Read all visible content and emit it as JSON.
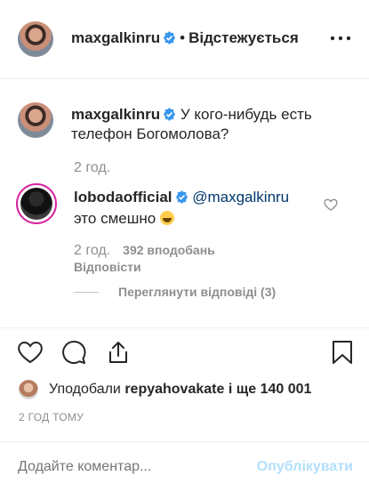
{
  "header": {
    "username": "maxgalkinru",
    "separator": "•",
    "follow_state": "Відстежується"
  },
  "caption": {
    "username": "maxgalkinru",
    "text": "У кого-нибудь есть телефон Богомолова?",
    "time": "2 год."
  },
  "comment": {
    "username": "lobodaofficial",
    "mention": "@maxgalkinru",
    "text": "это смешно",
    "time": "2 год.",
    "likes": "392 вподобань",
    "reply_label": "Відповісти",
    "view_replies": "Переглянути відповіді (3)"
  },
  "likes": {
    "prefix": "Уподобали",
    "user": "repyahovakate",
    "suffix": "і ще 140 001"
  },
  "timestamp": "2 ГОД ТОМУ",
  "comment_box": {
    "placeholder": "Додайте коментар...",
    "post_label": "Опублікувати"
  },
  "colors": {
    "verified": "#3897f0",
    "muted": "#8e8e8e",
    "post_disabled": "#b2dffc",
    "story_ring": "#d6249f"
  },
  "icons": [
    "more-icon",
    "verified-icon",
    "heart-icon",
    "comment-icon",
    "share-icon",
    "save-icon",
    "smile-emoji-icon"
  ]
}
